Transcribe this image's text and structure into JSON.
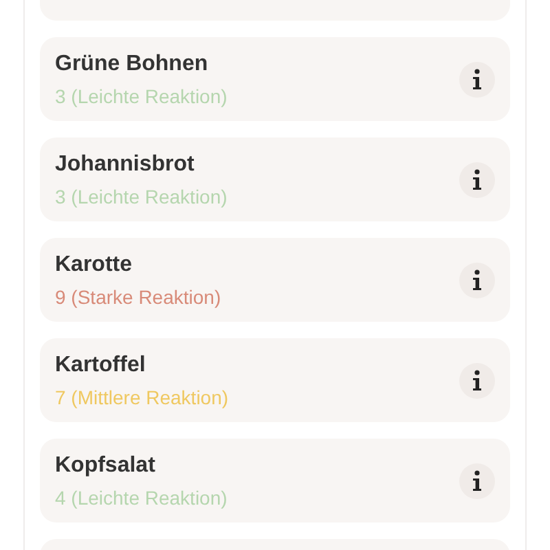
{
  "foods": [
    {
      "name": "Grüne Bohnen",
      "reaction": "3 (Leichte Reaktion)",
      "kind": "light"
    },
    {
      "name": "Johannisbrot",
      "reaction": "3 (Leichte Reaktion)",
      "kind": "light"
    },
    {
      "name": "Karotte",
      "reaction": "9 (Starke Reaktion)",
      "kind": "strong"
    },
    {
      "name": "Kartoffel",
      "reaction": "7 (Mittlere Reaktion)",
      "kind": "medium"
    },
    {
      "name": "Kopfsalat",
      "reaction": "4 (Leichte Reaktion)",
      "kind": "light"
    }
  ]
}
